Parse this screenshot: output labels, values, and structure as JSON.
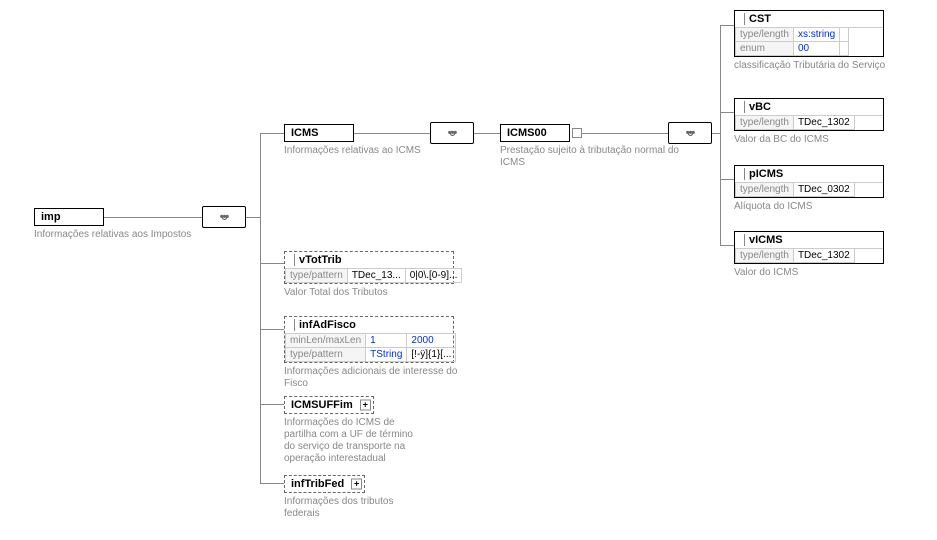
{
  "root": {
    "name": "imp",
    "desc": "Informações relativas aos Impostos"
  },
  "icms": {
    "name": "ICMS",
    "desc": "Informações relativas ao ICMS"
  },
  "icms00": {
    "name": "ICMS00",
    "desc": "Prestação sujeito à tributação normal do ICMS"
  },
  "vTotTrib": {
    "name": "vTotTrib",
    "rows": [
      {
        "k": "type/pattern",
        "v1": "TDec_13...",
        "v2": "0|0\\.[0-9]..."
      }
    ],
    "desc": "Valor Total dos Tributos"
  },
  "infAdFisco": {
    "name": "infAdFisco",
    "rows": [
      {
        "k": "minLen/maxLen",
        "v1": "1",
        "v2": "2000"
      },
      {
        "k": "type/pattern",
        "v1": "TString",
        "v2": "[!-ÿ]{1}[..."
      }
    ],
    "desc": "Informações adicionais de interesse do Fisco"
  },
  "icmsUFFim": {
    "name": "ICMSUFFim",
    "desc": "Informações do ICMS de partilha com a UF de término do serviço de transporte na operação interestadual"
  },
  "infTribFed": {
    "name": "infTribFed",
    "desc": "Informações dos tributos federais"
  },
  "cst": {
    "name": "CST",
    "rows": [
      {
        "k": "type/length",
        "v": "xs:string",
        "blue": true
      },
      {
        "k": "enum",
        "v": "00",
        "blue": true
      }
    ],
    "desc": "classificação Tributária do Serviço"
  },
  "vbc": {
    "name": "vBC",
    "rows": [
      {
        "k": "type/length",
        "v": "TDec_1302"
      }
    ],
    "desc": "Valor da BC do ICMS"
  },
  "picms": {
    "name": "pICMS",
    "rows": [
      {
        "k": "type/length",
        "v": "TDec_0302"
      }
    ],
    "desc": "Alíquota do ICMS"
  },
  "vicms": {
    "name": "vICMS",
    "rows": [
      {
        "k": "type/length",
        "v": "TDec_1302"
      }
    ],
    "desc": "Valor do ICMS"
  },
  "plus": "+"
}
